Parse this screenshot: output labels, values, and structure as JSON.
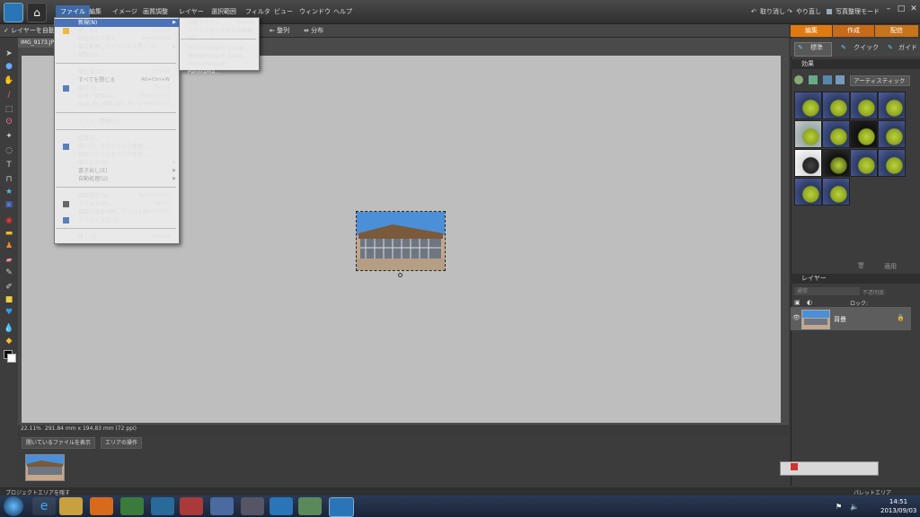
{
  "menubar": {
    "items": [
      "ファイル",
      "編集",
      "イメージ",
      "画質調整",
      "レイヤー",
      "選択範囲",
      "フィルタ",
      "ビュー",
      "ウィンドウ",
      "ヘルプ"
    ],
    "undo": "取り消し",
    "redo": "やり直し",
    "mode": "写真整理モード"
  },
  "options_bar": {
    "auto_select": "レイヤーを自動選択",
    "align": "整列",
    "distribute": "分布"
  },
  "document": {
    "tab": "IMG_9173.JPG",
    "zoom": "22.11%",
    "size": "291.84 mm x 194.83 mm (72 ppi)"
  },
  "file_menu": {
    "items": [
      {
        "label": "新規(N)",
        "shortcut": "",
        "submenu": true
      },
      {
        "label": "開く(O)...",
        "shortcut": "Ctrl+O"
      },
      {
        "label": "指定形式で開く...",
        "shortcut": "Alt+Ctrl+O"
      },
      {
        "label": "最近編集したファイルを開く(T)",
        "shortcut": "",
        "submenu": true
      },
      {
        "label": "複製(D)...",
        "shortcut": ""
      },
      {
        "label": "閉じる(C)",
        "shortcut": "Ctrl+W"
      },
      {
        "label": "すべてを閉じる",
        "shortcut": "Alt+Ctrl+W",
        "disabled": true
      },
      {
        "label": "保存(S)",
        "shortcut": "Ctrl+S"
      },
      {
        "label": "別名で保存(A)...",
        "shortcut": "Shift+Ctrl+S"
      },
      {
        "label": "Web 用に保存(W)...",
        "shortcut": "Alt+Shift+Ctrl+S"
      },
      {
        "label": "ファイル情報(F)...",
        "shortcut": ""
      },
      {
        "label": "配置(L)...",
        "shortcut": ""
      },
      {
        "label": "開いているファイルを整理...",
        "shortcut": ""
      },
      {
        "label": "複数ファイルをバッチ処理...",
        "shortcut": ""
      },
      {
        "label": "読み込み(M)",
        "shortcut": "",
        "submenu": true
      },
      {
        "label": "書き出し(E)",
        "shortcut": "",
        "submenu": true,
        "disabled": true
      },
      {
        "label": "自動処理(U)",
        "shortcut": "",
        "submenu": true,
        "disabled": true
      },
      {
        "label": "用紙設定(G)...",
        "shortcut": "Shift+Ctrl+P"
      },
      {
        "label": "プリント(P)...",
        "shortcut": "Ctrl+P"
      },
      {
        "label": "複数写真を同時にプリント...",
        "shortcut": "Alt+Ctrl+P"
      },
      {
        "label": "プリント注文(O)...",
        "shortcut": ""
      },
      {
        "label": "終了(X)",
        "shortcut": "Ctrl+Q"
      }
    ]
  },
  "new_submenu": {
    "items": [
      {
        "label": "白紙ファイル...",
        "shortcut": "Ctrl+N"
      },
      {
        "label": "クリップボードからの画像(D)",
        "shortcut": ""
      },
      {
        "label": "Photomerge® Group Shot...",
        "shortcut": ""
      },
      {
        "label": "Photomerge® Faces...",
        "shortcut": ""
      },
      {
        "label": "Photomerge® Panorama...",
        "shortcut": ""
      }
    ]
  },
  "right_panel": {
    "tabs": [
      "編集",
      "作成",
      "配信"
    ],
    "subtabs": [
      "標準",
      "クイック",
      "ガイド"
    ],
    "effects_title": "効果",
    "effects_filter": "アーティスティック",
    "apply": "適用",
    "layers_title": "レイヤー",
    "blend": "通常",
    "opacity_label": "不透明度:",
    "lock": "ロック:",
    "layer_name": "背景"
  },
  "project_bin": {
    "show_files": "開いているファイルを表示",
    "bin_actions": "エリアの操作",
    "hide": "プロジェクトエリアを隠す",
    "palette": "パレットエリア"
  },
  "taskbar": {
    "time": "14:51",
    "date": "2013/09/03"
  },
  "colors": {
    "mode_edit": "#e07a10",
    "mode_create": "#d4701a",
    "mode_share": "#c8741a",
    "highlight": "#4a73b8"
  }
}
